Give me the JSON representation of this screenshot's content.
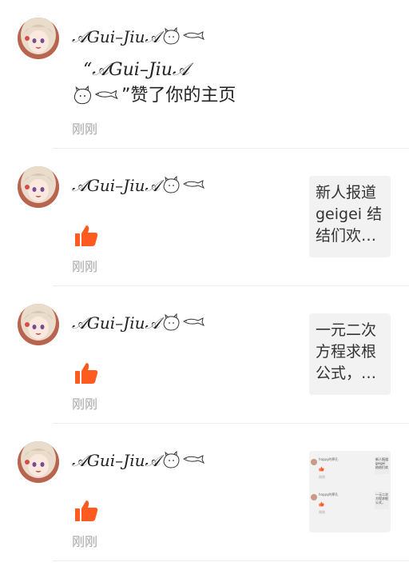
{
  "notifications": [
    {
      "username_script": "𝒜Gui–Jiu𝒜",
      "message_line1": "“𝒜Gui–Jiu𝒜",
      "message_line2": "”赞了你的主页",
      "time": "刚刚"
    },
    {
      "username_script": "𝒜Gui–Jiu𝒜",
      "time": "刚刚",
      "preview_text": "新人报道geigei 结结们欢…"
    },
    {
      "username_script": "𝒜Gui–Jiu𝒜",
      "time": "刚刚",
      "preview_text": "一元二次方程求根公式，…"
    },
    {
      "username_script": "𝒜Gui–Jiu𝒜",
      "time": "刚刚",
      "mini_items": [
        {
          "name": "happy的罪孔",
          "time": "刚刚",
          "box_text": "新人报道geigei 结结们欢"
        },
        {
          "name": "happy的罪孔",
          "time": "刚刚",
          "box_text": "一元二次方程求根公式，"
        }
      ]
    }
  ],
  "colors": {
    "like": "#ff5a1f",
    "muted": "#a6a6a6",
    "preview_bg": "#f2f2f2"
  },
  "icons": [
    "avatar",
    "cat-fish-doodle-icon",
    "thumbs-up-icon"
  ]
}
